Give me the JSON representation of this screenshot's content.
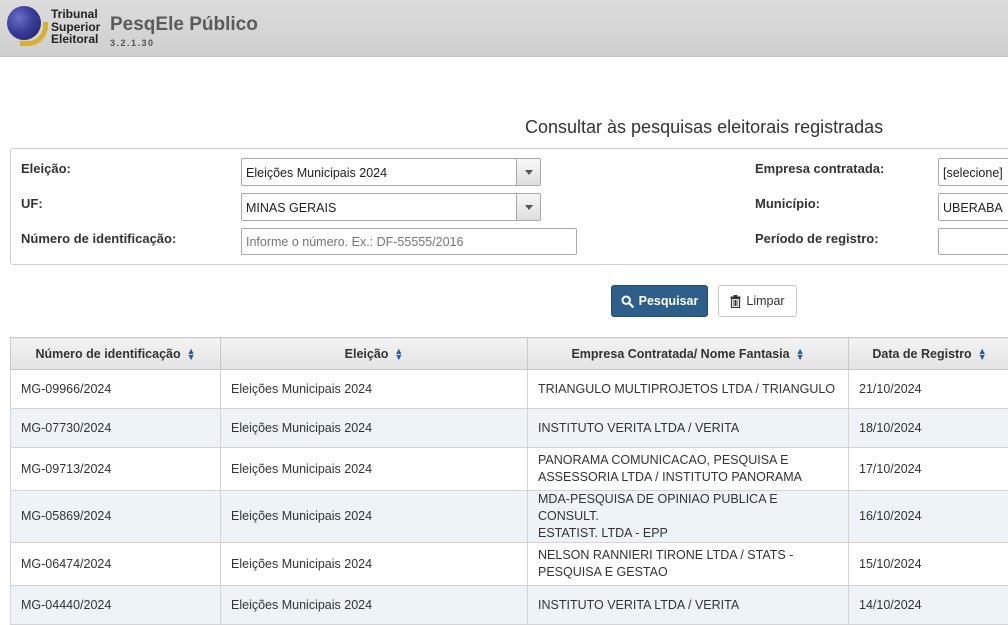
{
  "header": {
    "logo_lines": [
      "Tribunal",
      "Superior",
      "Eleitoral"
    ],
    "app_title": "PesqEle Público",
    "version": "3.2.1.30"
  },
  "page": {
    "heading": "Consultar às pesquisas eleitorais registradas"
  },
  "filters": {
    "eleicao_label": "Eleição:",
    "eleicao_value": "Eleições Municipais 2024",
    "uf_label": "UF:",
    "uf_value": "MINAS GERAIS",
    "numero_label": "Número de identificação:",
    "numero_placeholder": "Informe o número. Ex.: DF-55555/2016",
    "empresa_label": "Empresa contratada:",
    "empresa_value": "[selecione]",
    "municipio_label": "Município:",
    "municipio_value": "UBERABA",
    "periodo_label": "Período de registro:",
    "periodo_value": ""
  },
  "actions": {
    "search_label": "Pesquisar",
    "clear_label": "Limpar"
  },
  "table": {
    "columns": [
      "Número de identificação",
      "Eleição",
      "Empresa Contratada/ Nome Fantasia",
      "Data de Registro"
    ],
    "rows": [
      {
        "numero": "MG-09966/2024",
        "eleicao": "Eleições Municipais 2024",
        "empresa_lines": [
          "TRIANGULO MULTIPROJETOS LTDA / TRIANGULO"
        ],
        "data": "21/10/2024"
      },
      {
        "numero": "MG-07730/2024",
        "eleicao": "Eleições Municipais 2024",
        "empresa_lines": [
          "INSTITUTO VERITA LTDA / VERITA"
        ],
        "data": "18/10/2024"
      },
      {
        "numero": "MG-09713/2024",
        "eleicao": "Eleições Municipais 2024",
        "empresa_lines": [
          "PANORAMA COMUNICACAO, PESQUISA E",
          "ASSESSORIA LTDA / INSTITUTO PANORAMA"
        ],
        "data": "17/10/2024"
      },
      {
        "numero": "MG-05869/2024",
        "eleicao": "Eleições Municipais 2024",
        "empresa_lines": [
          "MDA-PESQUISA DE OPINIAO PUBLICA E CONSULT.",
          "ESTATIST. LTDA - EPP"
        ],
        "data": "16/10/2024"
      },
      {
        "numero": "MG-06474/2024",
        "eleicao": "Eleições Municipais 2024",
        "empresa_lines": [
          "NELSON RANNIERI TIRONE LTDA / STATS -",
          "PESQUISA E GESTAO"
        ],
        "data": "15/10/2024"
      },
      {
        "numero": "MG-04440/2024",
        "eleicao": "Eleições Municipais 2024",
        "empresa_lines": [
          "INSTITUTO VERITA LTDA / VERITA"
        ],
        "data": "14/10/2024"
      }
    ]
  },
  "icons": {
    "search": "magnifier-icon",
    "clear": "trash-icon",
    "sort": "sort-arrows-icon",
    "dropdown": "caret-down-icon"
  },
  "colors": {
    "primary": "#2d5f8a",
    "header_bg": "#d6d6d6",
    "row_alt": "#eef3f8",
    "logo_blue": "#3a3d9a",
    "logo_gold": "#d6b22c"
  }
}
